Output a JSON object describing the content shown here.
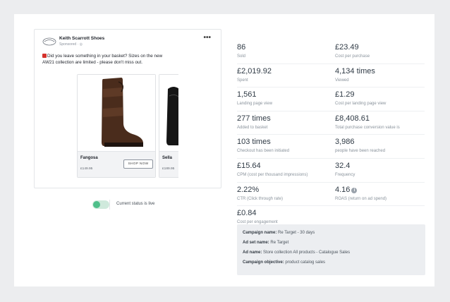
{
  "ad": {
    "brand": "Keith Scarrott Shoes",
    "sponsored": "Sponsored",
    "more_icon": "more-dots-icon",
    "text": "Did you leave something in your basket? Sizes on the new AW21 collection are limited - please don't miss out.",
    "products": [
      {
        "name": "Fangosa",
        "price": "£149.95",
        "button": "SHOP NOW"
      },
      {
        "name": "Sella",
        "price": "£189.95"
      }
    ]
  },
  "status": {
    "live": true,
    "label": "Current status is live"
  },
  "metrics": [
    [
      {
        "value": "86",
        "label": "Sold"
      },
      {
        "value": "£23.49",
        "label": "Cost per purchase"
      }
    ],
    [
      {
        "value": "£2,019.92",
        "label": "Spent"
      },
      {
        "value": "4,134 times",
        "label": "Viewed"
      }
    ],
    [
      {
        "value": "1,561",
        "label": "Landing page view"
      },
      {
        "value": "£1.29",
        "label": "Cost per landing page view"
      }
    ],
    [
      {
        "value": "277 times",
        "label": "Added to basket"
      },
      {
        "value": "£8,408.61",
        "label": "Total purchase conversion value is"
      }
    ],
    [
      {
        "value": "103 times",
        "label": "Checkout has been initiated"
      },
      {
        "value": "3,986",
        "label": "people have been reached"
      }
    ],
    [
      {
        "value": "£15.64",
        "label": "CPM (cost per thousand impressions)"
      },
      {
        "value": "32.4",
        "label": "Frequency"
      }
    ],
    [
      {
        "value": "2.22%",
        "label": "CTR (Click through rate)"
      },
      {
        "value": "4.16",
        "label": "ROAS (return on ad spend)"
      }
    ],
    [
      {
        "value": "£0.84",
        "label": "Cost per engagement"
      }
    ]
  ],
  "campaign": {
    "name_label": "Campaign name:",
    "name": "Re Target - 30 days",
    "adset_label": "Ad set name:",
    "adset": "Re Target",
    "ad_label": "Ad name:",
    "ad": "Store collection All products - Catalogue Sales",
    "objective_label": "Campaign objective:",
    "objective": "product catalog sales"
  }
}
